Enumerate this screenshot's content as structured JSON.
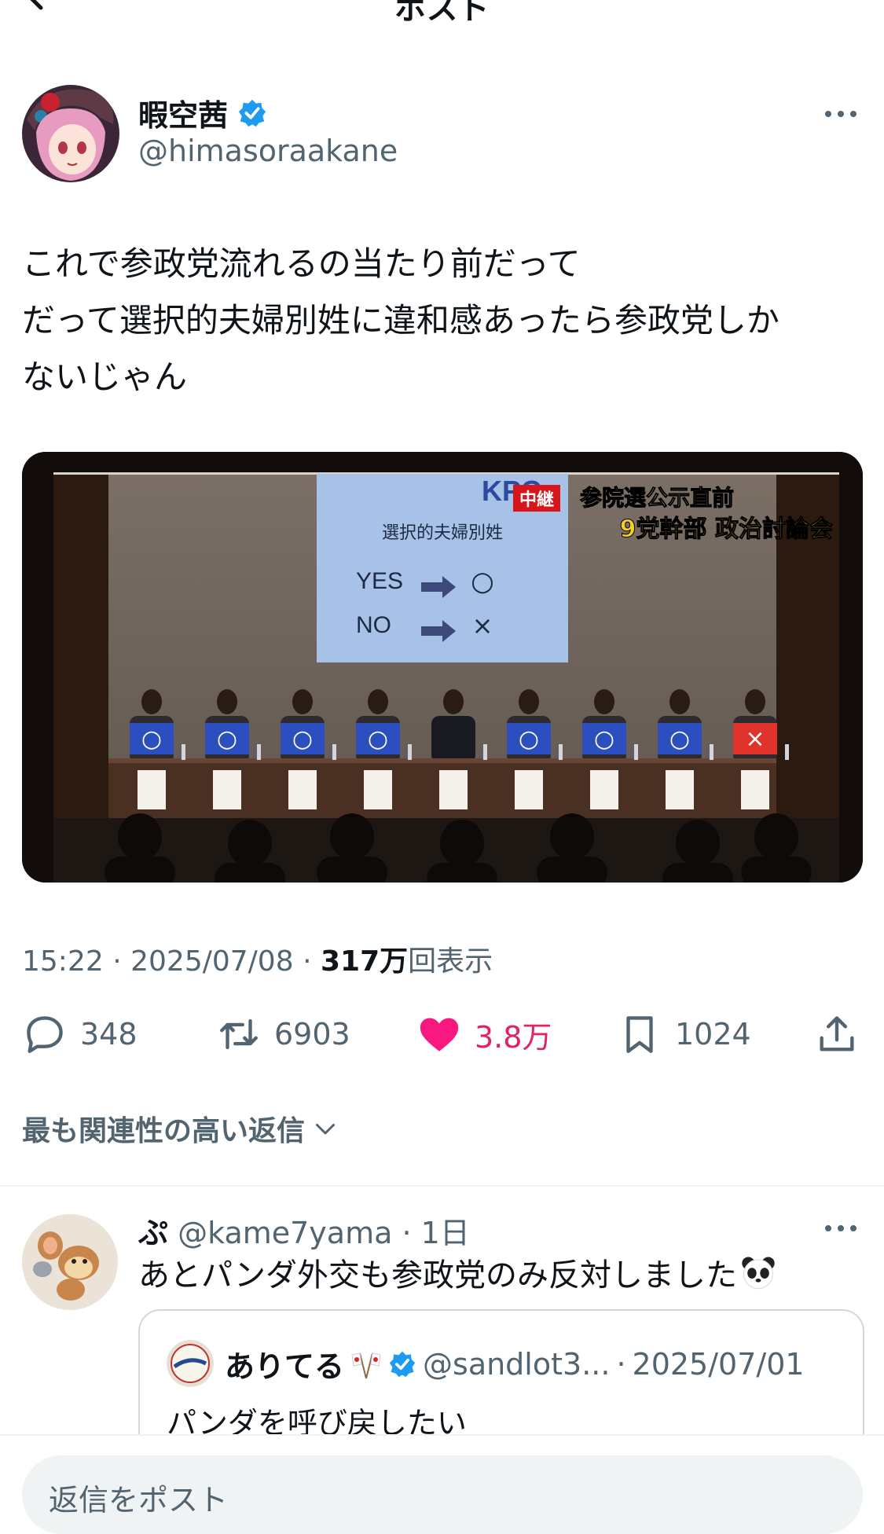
{
  "header": {
    "title": "ポスト"
  },
  "author": {
    "name": "暇空茜",
    "handle": "@himasoraakane"
  },
  "post": {
    "lines": [
      "これで参政党流れるの当たり前だって",
      "だって選択的夫婦別姓に違和感あったら参政党しか",
      "ないじゃん"
    ]
  },
  "media": {
    "broadcaster": "KPC",
    "live_tag": "中継",
    "caption_line1": "参院選公示直前",
    "caption_line2": "9党幹部 政治討論会",
    "screen_title": "選択的夫婦別姓",
    "screen_yes": "YES",
    "screen_yes_mark": "○",
    "screen_no": "NO",
    "screen_no_mark": "×",
    "answers": [
      "○",
      "○",
      "○",
      "○",
      "",
      "○",
      "○",
      "○",
      "×"
    ]
  },
  "meta": {
    "time": "15:22",
    "sep": "·",
    "date": "2025/07/08",
    "views_num": "317万",
    "views_label": "回表示"
  },
  "actions": {
    "replies": "348",
    "reposts": "6903",
    "likes": "3.8万",
    "bookmarks": "1024"
  },
  "replies_sort": "最も関連性の高い返信",
  "reply": {
    "name": "ぷ",
    "handle": "@kame7yama",
    "sep": "·",
    "time": "1日",
    "text": "あとパンダ外交も参政党のみ反対しました",
    "quote": {
      "name": "ありてる",
      "handle": "@sandlot3...",
      "sep": "·",
      "date": "2025/07/01",
      "text": "パンダを呼び戻したい"
    }
  },
  "compose": {
    "placeholder": "返信をポスト"
  },
  "colors": {
    "accent_blue": "#1d9bf0",
    "like_pink": "#f91880",
    "muted": "#536471"
  }
}
